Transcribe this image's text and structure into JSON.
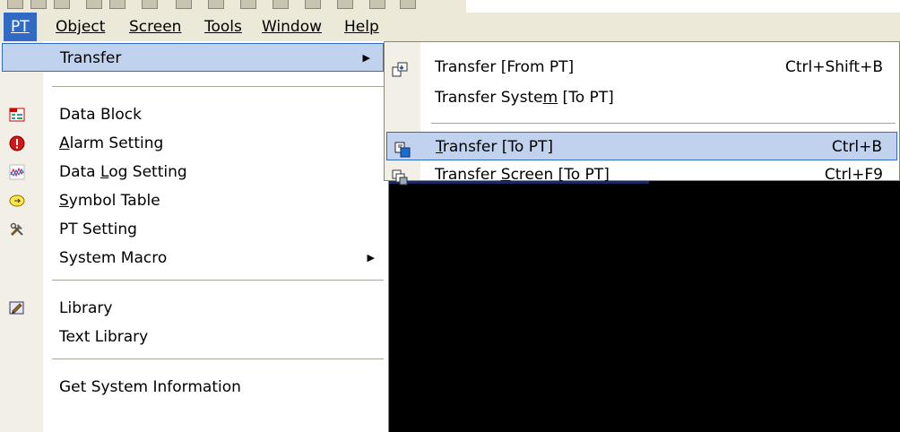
{
  "menubar": [
    {
      "label": "PT",
      "active": true
    },
    {
      "label": "Object"
    },
    {
      "label": "Screen"
    },
    {
      "label": "Tools"
    },
    {
      "label": "Window"
    },
    {
      "label": "Help"
    }
  ],
  "menu": {
    "transfer": "Transfer",
    "data_block": "Data Block",
    "alarm_setting": "Alarm Setting",
    "data_log_setting": "Data Log Setting",
    "symbol_table": "Symbol Table",
    "pt_setting": "PT Setting",
    "system_macro": "System Macro",
    "library": "Library",
    "text_library": "Text Library",
    "get_system_information": "Get System Information"
  },
  "submenu": {
    "from_pt": {
      "label": "Transfer [From PT]",
      "shortcut": "Ctrl+Shift+B"
    },
    "system_to_pt": {
      "label": "Transfer System [To PT]"
    },
    "to_pt": {
      "label": "Transfer [To PT]",
      "shortcut": "Ctrl+B"
    },
    "screen_to_pt": {
      "label": "Transfer Screen [To PT]",
      "shortcut": "Ctrl+F9"
    }
  },
  "icons": {
    "data_block": "data-block-icon",
    "alarm": "alarm-icon",
    "data_log": "data-log-icon",
    "symbol_table": "symbol-table-icon",
    "pt_setting": "tools-icon",
    "library": "library-icon"
  },
  "colors": {
    "highlight": "#c1d2ee",
    "highlight_border": "#316ac5",
    "menubar_bg": "#ece9d8",
    "gutter": "#f2f0e6"
  }
}
